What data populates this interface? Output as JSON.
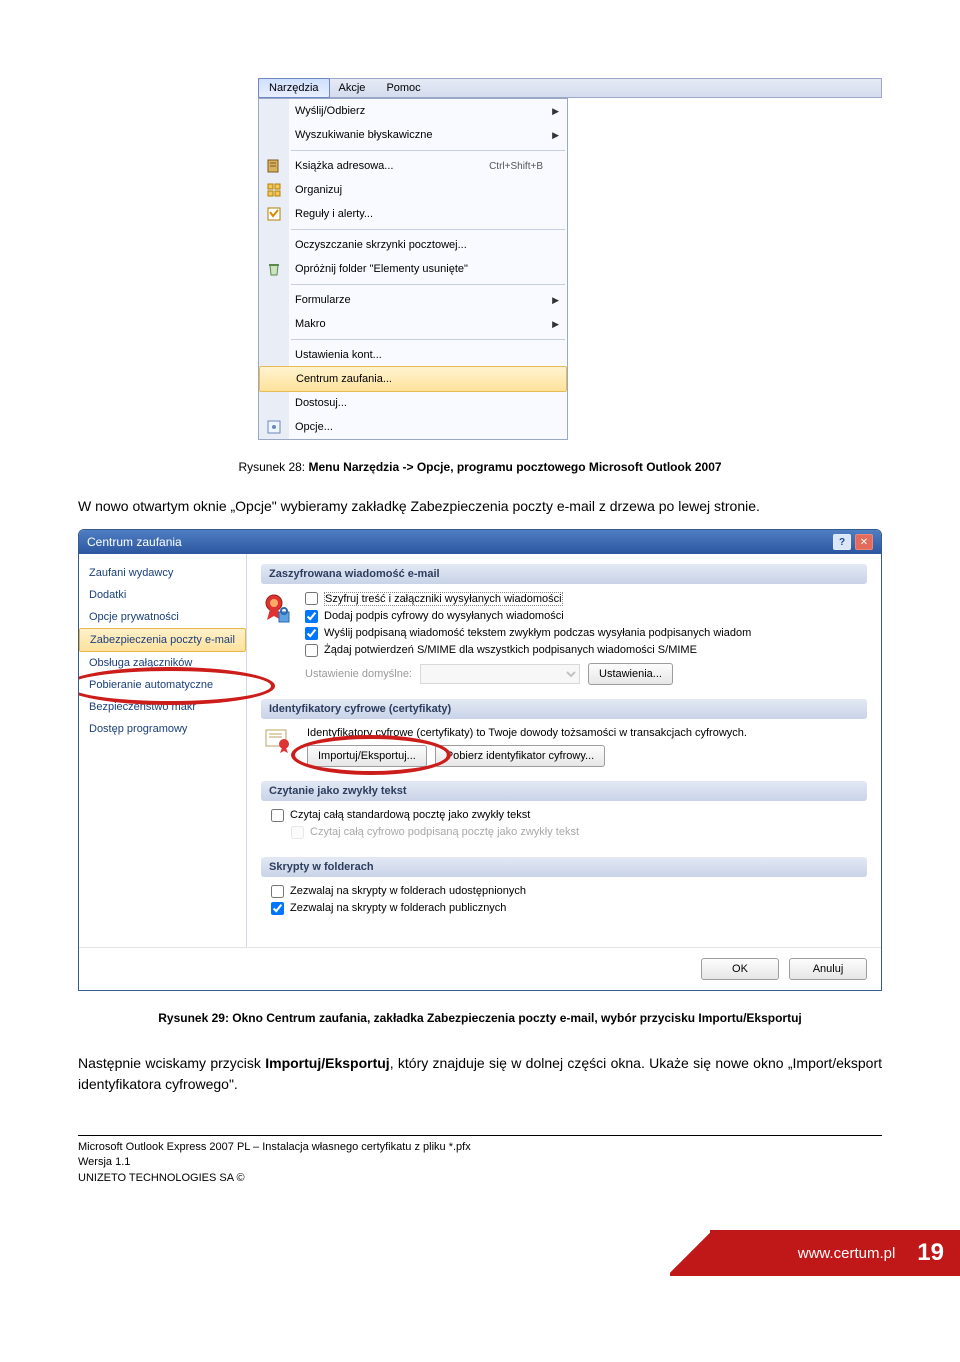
{
  "menubar": {
    "items": [
      "Narzędzia",
      "Akcje",
      "Pomoc"
    ]
  },
  "dropdown": {
    "items": [
      {
        "label": "Wyślij/Odbierz",
        "arrow": true
      },
      {
        "label": "Wyszukiwanie błyskawiczne",
        "arrow": true
      },
      {
        "sep": true
      },
      {
        "label": "Książka adresowa...",
        "shortcut": "Ctrl+Shift+B",
        "icon": "book"
      },
      {
        "label": "Organizuj",
        "icon": "organize"
      },
      {
        "label": "Reguły i alerty...",
        "icon": "rules"
      },
      {
        "sep": true
      },
      {
        "label": "Oczyszczanie skrzynki pocztowej..."
      },
      {
        "label": "Opróżnij folder \"Elementy usunięte\"",
        "icon": "trash"
      },
      {
        "sep": true
      },
      {
        "label": "Formularze",
        "arrow": true
      },
      {
        "label": "Makro",
        "arrow": true
      },
      {
        "sep": true
      },
      {
        "label": "Ustawienia kont..."
      },
      {
        "label": "Centrum zaufania...",
        "highlight": true
      },
      {
        "label": "Dostosuj..."
      },
      {
        "label": "Opcje...",
        "icon": "options"
      }
    ]
  },
  "caption1": {
    "prefix": "Rysunek 28: ",
    "bold": "Menu Narzędzia -> Opcje, programu pocztowego Microsoft Outlook 2007"
  },
  "para1": "W nowo otwartym oknie „Opcje\" wybieramy zakładkę Zabezpieczenia poczty e-mail z drzewa po lewej stronie.",
  "trust": {
    "title": "Centrum zaufania",
    "nav": [
      "Zaufani wydawcy",
      "Dodatki",
      "Opcje prywatności",
      "Zabezpieczenia poczty e-mail",
      "Obsługa załączników",
      "Pobieranie automatyczne",
      "Bezpieczeństwo makr",
      "Dostęp programowy"
    ],
    "grp1": {
      "head": "Zaszyfrowana wiadomość e-mail",
      "c1": "Szyfruj treść i załączniki wysyłanych wiadomości",
      "c2": "Dodaj podpis cyfrowy do wysyłanych wiadomości",
      "c3": "Wyślij podpisaną wiadomość tekstem zwykłym podczas wysyłania podpisanych wiadom",
      "c4": "Żądaj potwierdzeń S/MIME dla wszystkich podpisanych wiadomości S/MIME",
      "dlab": "Ustawienie domyślne:",
      "btn": "Ustawienia..."
    },
    "grp2": {
      "head": "Identyfikatory cyfrowe (certyfikaty)",
      "desc": "Identyfikatory cyfrowe (certyfikaty) to Twoje dowody tożsamości w transakcjach cyfrowych.",
      "b1": "Importuj/Eksportuj...",
      "b2": "Pobierz identyfikator cyfrowy..."
    },
    "grp3": {
      "head": "Czytanie jako zwykły tekst",
      "c1": "Czytaj całą standardową pocztę jako zwykły tekst",
      "c2": "Czytaj całą cyfrowo podpisaną pocztę jako zwykły tekst"
    },
    "grp4": {
      "head": "Skrypty w folderach",
      "c1": "Zezwalaj na skrypty w folderach udostępnionych",
      "c2": "Zezwalaj na skrypty w folderach publicznych"
    },
    "ok": "OK",
    "cancel": "Anuluj"
  },
  "caption2": "Rysunek 29: Okno Centrum zaufania, zakładka Zabezpieczenia poczty e-mail, wybór przycisku Importu/Eksportuj",
  "para2": {
    "p1": "Następnie wciskamy przycisk ",
    "b": "Importuj/Eksportuj",
    "p2": ", który znajduje się w dolnej części okna. Ukaże się nowe okno „Import/eksport identyfikatora cyfrowego\"."
  },
  "footer": {
    "l1": "Microsoft Outlook Express 2007 PL – Instalacja własnego certyfikatu z pliku *.pfx",
    "l2": "Wersja 1.1",
    "l3": "UNIZETO TECHNOLOGIES SA ©",
    "url": "www.certum.pl",
    "page": "19"
  }
}
